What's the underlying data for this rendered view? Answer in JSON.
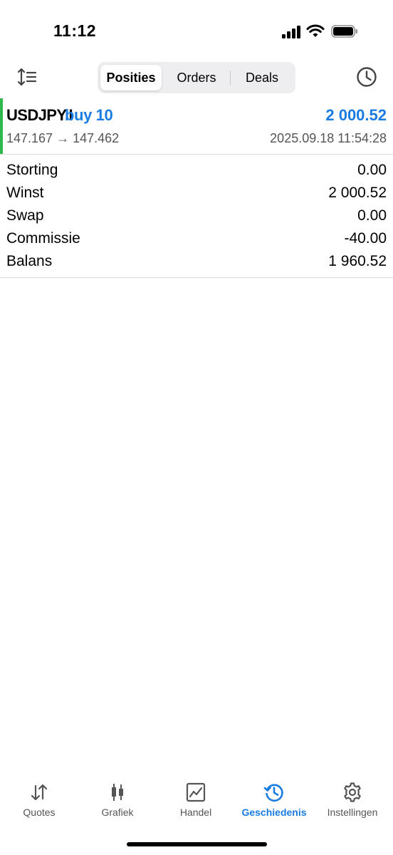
{
  "status_bar": {
    "time": "11:12"
  },
  "toolbar": {
    "tabs": [
      {
        "label": "Posities",
        "active": true
      },
      {
        "label": "Orders",
        "active": false
      },
      {
        "label": "Deals",
        "active": false
      }
    ],
    "left_icon": "sort-icon",
    "right_icon": "clock-icon"
  },
  "position": {
    "symbol": "USDJPY.I",
    "side": "buy 10",
    "profit": "2 000.52",
    "prices": "147.167 → 147.462",
    "datetime": "2025.09.18 11:54:28",
    "indicator_color": "#2fb84d"
  },
  "summary": [
    {
      "label": "Storting",
      "value": "0.00"
    },
    {
      "label": "Winst",
      "value": "2 000.52"
    },
    {
      "label": "Swap",
      "value": "0.00"
    },
    {
      "label": "Commissie",
      "value": "-40.00"
    },
    {
      "label": "Balans",
      "value": "1 960.52"
    }
  ],
  "tabbar": {
    "items": [
      {
        "label": "Quotes",
        "icon": "quotes-arrows-icon",
        "active": false
      },
      {
        "label": "Grafiek",
        "icon": "candlestick-icon",
        "active": false
      },
      {
        "label": "Handel",
        "icon": "trade-chart-icon",
        "active": false
      },
      {
        "label": "Geschiedenis",
        "icon": "history-icon",
        "active": true
      },
      {
        "label": "Instellingen",
        "icon": "settings-gear-icon",
        "active": false
      }
    ]
  },
  "colors": {
    "accent": "#1a7ce0",
    "buy_indicator": "#2fb84d",
    "text_secondary": "#555555"
  }
}
